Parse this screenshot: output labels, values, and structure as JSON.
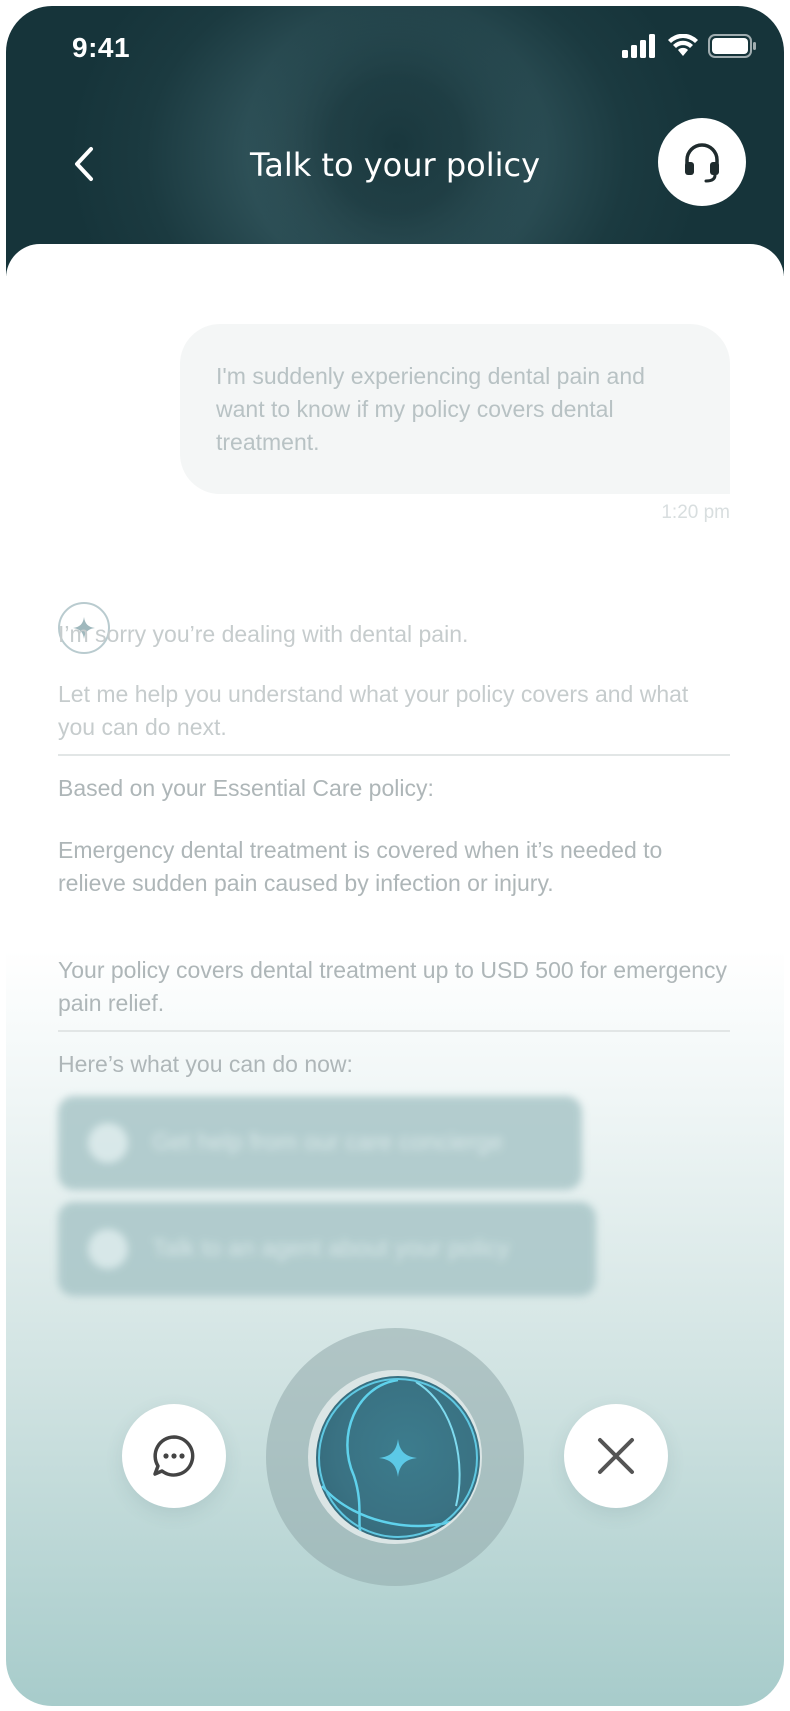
{
  "status_bar": {
    "time": "9:41"
  },
  "header": {
    "title": "Talk to your policy"
  },
  "conversation": {
    "user_message": {
      "text": "I'm suddenly experiencing dental pain and want to know if my policy covers dental treatment.",
      "time": "1:20 pm"
    },
    "assistant": {
      "intro": "I’m sorry you’re dealing with dental pain.",
      "help": "Let me help you understand what your policy covers and what you can do next.",
      "based_on": "Based on your Essential Care policy:",
      "coverage": "Emergency dental treatment is covered when it’s needed to relieve sudden pain caused by infection or injury.",
      "limit": "Your policy covers dental treatment up to USD 500 for emergency pain relief.",
      "next_steps": "Here’s what you can do now:",
      "actions": [
        {
          "label": "Get help from our care concierge",
          "icon": "chat-heart-icon"
        },
        {
          "label": "Talk to an agent about your policy",
          "icon": "headset-icon"
        }
      ]
    }
  },
  "controls": {
    "chat_icon": "chat-bubble-icon",
    "voice_icon": "sparkle-icon",
    "close_icon": "close-icon"
  },
  "colors": {
    "header_dark": "#1b3a40",
    "accent": "#4cc4e0",
    "bottom_gradient": "#a6cbca"
  }
}
